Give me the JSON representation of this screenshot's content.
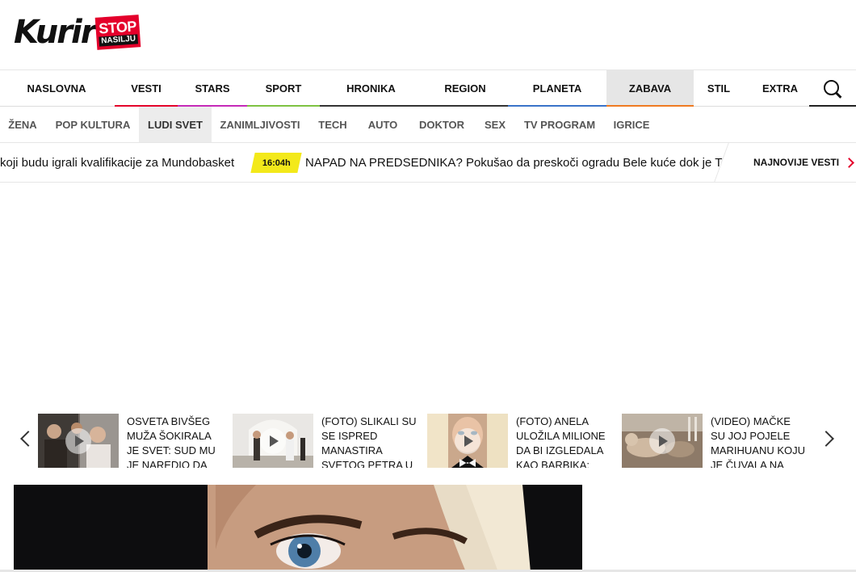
{
  "header": {
    "logo_text": "Kurir",
    "badge_top": "STOP",
    "badge_bottom": "NASILJU"
  },
  "main_nav": {
    "items": [
      {
        "label": "NASLOVNA",
        "underline": ""
      },
      {
        "label": "VESTI",
        "underline": "#e4002b"
      },
      {
        "label": "STARS",
        "underline": "#c52ab8"
      },
      {
        "label": "SPORT",
        "underline": "#7ec242"
      },
      {
        "label": "HRONIKA",
        "underline": "#333333"
      },
      {
        "label": "REGION",
        "underline": "#333333"
      },
      {
        "label": "PLANETA",
        "underline": "#3a73c9"
      },
      {
        "label": "ZABAVA",
        "underline": "#ef7a22"
      },
      {
        "label": "STIL",
        "underline": ""
      },
      {
        "label": "EXTRA",
        "underline": ""
      }
    ],
    "active_index": 7
  },
  "sub_nav": {
    "items": [
      "ŽENA",
      "POP KULTURA",
      "LUDI SVET",
      "ZANIMLJIVOSTI",
      "TECH",
      "AUTO",
      "DOKTOR",
      "SEX",
      "TV PROGRAM",
      "IGRICE"
    ],
    "active_index": 2
  },
  "ticker": {
    "prev_text": "koji budu igrali kvalifikacije za Mundobasket",
    "time": "16:04h",
    "headline": "NAPAD NA PREDSEDNIKA? Pokušao da preskoči ogradu Bele kuće dok je Tramp bio",
    "latest_label": "NAJNOVIJE VESTI"
  },
  "carousel": {
    "items": [
      {
        "title": "OSVETA BIVŠEG MUŽA ŠOKIRALA JE SVET: Sud mu je naredio da plaća"
      },
      {
        "title": "(FOTO) SLIKALI SU SE ISPRED MANASTIRA SVETOG PETRA U GRČKOJ"
      },
      {
        "title": "(FOTO) ANELA ULOŽILA MILIONE DA BI IZGLEDALA KAO BARBIKA: Ljudi"
      },
      {
        "title": "(VIDEO) MAČKE SU JOJ POJELE MARIHUANU KOJU JE ČUVALA NA"
      }
    ]
  },
  "colors": {
    "brand_red": "#e4002b",
    "time_badge": "#f3e91a"
  }
}
